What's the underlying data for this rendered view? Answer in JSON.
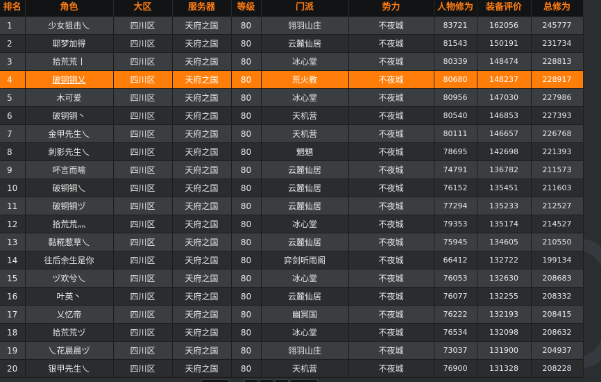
{
  "table": {
    "headers": [
      "排名",
      "角色",
      "大区",
      "服务器",
      "等级",
      "门派",
      "势力",
      "人物修为",
      "装备评价",
      "总修为"
    ],
    "highlight_index": 3,
    "rows": [
      [
        "1",
        "少女狙击乀",
        "四川区",
        "天府之国",
        "80",
        "翎羽山庄",
        "不夜城",
        "83721",
        "162056",
        "245777"
      ],
      [
        "2",
        "耶梦加得",
        "四川区",
        "天府之国",
        "80",
        "云麓仙居",
        "不夜城",
        "81543",
        "150191",
        "231734"
      ],
      [
        "3",
        "拾荒荒丨",
        "四川区",
        "天府之国",
        "80",
        "冰心堂",
        "不夜城",
        "80339",
        "148474",
        "228813"
      ],
      [
        "4",
        "破铜铜乂",
        "四川区",
        "天府之国",
        "80",
        "荒火教",
        "不夜城",
        "80680",
        "148237",
        "228917"
      ],
      [
        "5",
        "木可爱",
        "四川区",
        "天府之国",
        "80",
        "冰心堂",
        "不夜城",
        "80956",
        "147030",
        "227986"
      ],
      [
        "6",
        "破铜铜丶",
        "四川区",
        "天府之国",
        "80",
        "天机营",
        "不夜城",
        "80540",
        "146853",
        "227393"
      ],
      [
        "7",
        "金甲先生乀",
        "四川区",
        "天府之国",
        "80",
        "天机营",
        "不夜城",
        "80111",
        "146657",
        "226768"
      ],
      [
        "8",
        "刺影先生乀",
        "四川区",
        "天府之国",
        "80",
        "魍魉",
        "不夜城",
        "78695",
        "142698",
        "221393"
      ],
      [
        "9",
        "吥言而喻",
        "四川区",
        "天府之国",
        "80",
        "云麓仙居",
        "不夜城",
        "74791",
        "136782",
        "211573"
      ],
      [
        "10",
        "破铜铜乀",
        "四川区",
        "天府之国",
        "80",
        "云麓仙居",
        "不夜城",
        "76152",
        "135451",
        "211603"
      ],
      [
        "11",
        "破铜铜ヅ",
        "四川区",
        "天府之国",
        "80",
        "云麓仙居",
        "不夜城",
        "77294",
        "135233",
        "212527"
      ],
      [
        "12",
        "拾荒荒灬",
        "四川区",
        "天府之国",
        "80",
        "冰心堂",
        "不夜城",
        "79353",
        "135174",
        "214527"
      ],
      [
        "13",
        "黏糀惹草乀",
        "四川区",
        "天府之国",
        "80",
        "云麓仙居",
        "不夜城",
        "75945",
        "134605",
        "210550"
      ],
      [
        "14",
        "往后余生是你",
        "四川区",
        "天府之国",
        "80",
        "弈剑听雨阁",
        "不夜城",
        "66412",
        "132722",
        "199134"
      ],
      [
        "15",
        "ヅ欢兮乀",
        "四川区",
        "天府之国",
        "80",
        "冰心堂",
        "不夜城",
        "76053",
        "132630",
        "208683"
      ],
      [
        "16",
        "叶英丶",
        "四川区",
        "天府之国",
        "80",
        "云麓仙居",
        "不夜城",
        "76077",
        "132255",
        "208332"
      ],
      [
        "17",
        "乂忆帝",
        "四川区",
        "天府之国",
        "80",
        "幽冥国",
        "不夜城",
        "76222",
        "132193",
        "208415"
      ],
      [
        "18",
        "拾荒荒ヅ",
        "四川区",
        "天府之国",
        "80",
        "冰心堂",
        "不夜城",
        "76534",
        "132098",
        "208632"
      ],
      [
        "19",
        "乀花晨晨ヅ",
        "四川区",
        "天府之国",
        "80",
        "翎羽山庄",
        "不夜城",
        "73037",
        "131900",
        "204937"
      ],
      [
        "20",
        "银甲先生乀",
        "四川区",
        "天府之国",
        "80",
        "天机营",
        "不夜城",
        "76900",
        "131328",
        "208228"
      ]
    ]
  },
  "colors": {
    "header_text": "#ff7d14",
    "highlight_row": "#ff7e0a",
    "row_light": "#3b3e41",
    "row_dark": "#2a2c2e"
  }
}
